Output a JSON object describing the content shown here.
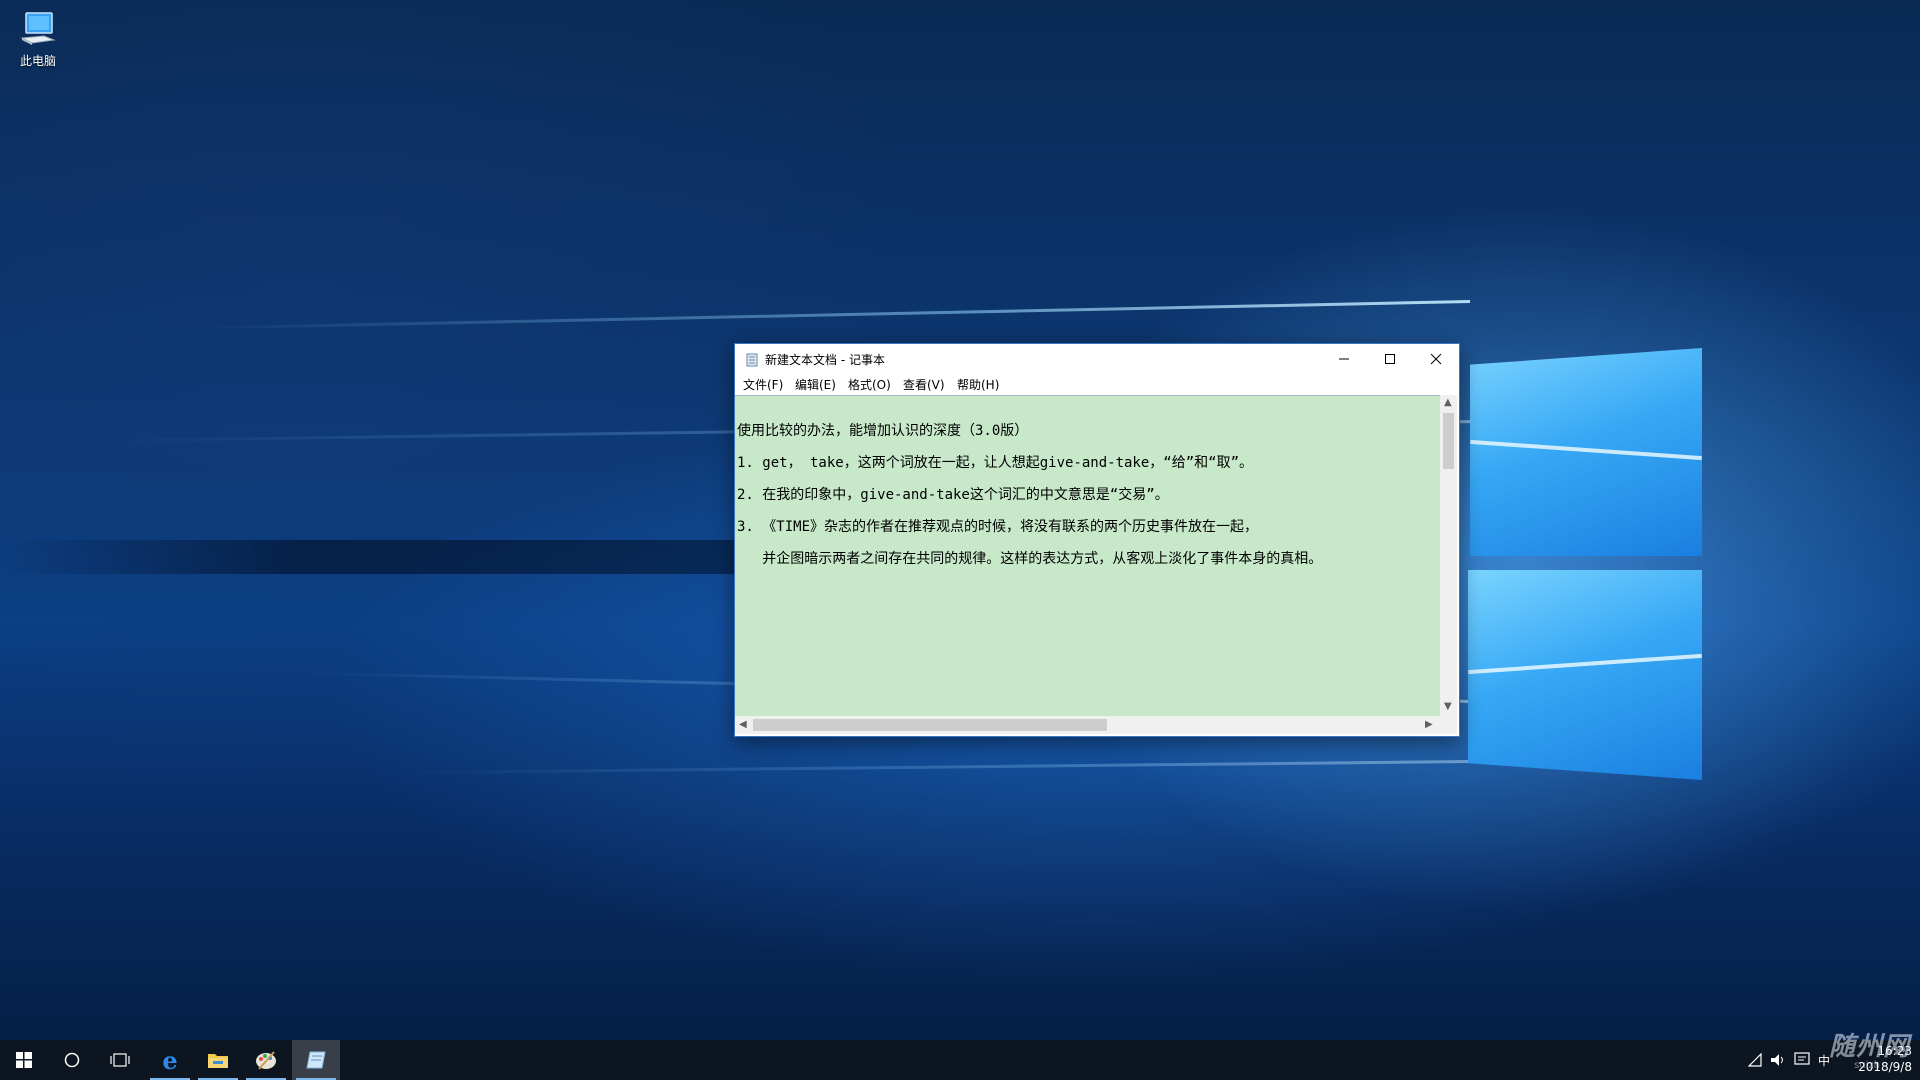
{
  "desktop": {
    "icons": [
      {
        "label": "此电脑",
        "icon": "this-pc-icon"
      }
    ]
  },
  "notepad": {
    "title": "新建文本文档 - 记事本",
    "menu": [
      "文件(F)",
      "编辑(E)",
      "格式(O)",
      "查看(V)",
      "帮助(H)"
    ],
    "lines": [
      "使用比较的办法，能增加认识的深度（3.0版）",
      "1. get， take，这两个词放在一起，让人想起give-and-take，“给”和“取”。",
      "2. 在我的印象中，give-and-take这个词汇的中文意思是“交易”。",
      "3. 《TIME》杂志的作者在推荐观点的时候，将没有联系的两个历史事件放在一起，",
      "   并企图暗示两者之间存在共同的规律。这样的表达方式，从客观上淡化了事件本身的真相。"
    ],
    "editor_background": "#c7e8c9"
  },
  "taskbar": {
    "apps": [
      "start-icon",
      "search-icon",
      "task-view-icon",
      "edge-icon",
      "file-explorer-icon",
      "paint-icon",
      "notepad-icon"
    ],
    "tray": {
      "ime": "中",
      "time": "16:23",
      "date": "2018/9/8"
    }
  },
  "watermark": {
    "text": "随州网",
    "sub": "suizh"
  }
}
